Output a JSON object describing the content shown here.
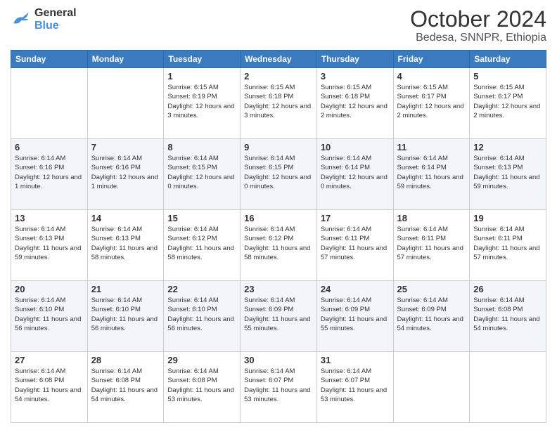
{
  "header": {
    "logo": {
      "general": "General",
      "blue": "Blue"
    },
    "month": "October 2024",
    "location": "Bedesa, SNNPR, Ethiopia"
  },
  "weekdays": [
    "Sunday",
    "Monday",
    "Tuesday",
    "Wednesday",
    "Thursday",
    "Friday",
    "Saturday"
  ],
  "weeks": [
    [
      {
        "day": "",
        "info": ""
      },
      {
        "day": "",
        "info": ""
      },
      {
        "day": "1",
        "info": "Sunrise: 6:15 AM\nSunset: 6:19 PM\nDaylight: 12 hours and 3 minutes."
      },
      {
        "day": "2",
        "info": "Sunrise: 6:15 AM\nSunset: 6:18 PM\nDaylight: 12 hours and 3 minutes."
      },
      {
        "day": "3",
        "info": "Sunrise: 6:15 AM\nSunset: 6:18 PM\nDaylight: 12 hours and 2 minutes."
      },
      {
        "day": "4",
        "info": "Sunrise: 6:15 AM\nSunset: 6:17 PM\nDaylight: 12 hours and 2 minutes."
      },
      {
        "day": "5",
        "info": "Sunrise: 6:15 AM\nSunset: 6:17 PM\nDaylight: 12 hours and 2 minutes."
      }
    ],
    [
      {
        "day": "6",
        "info": "Sunrise: 6:14 AM\nSunset: 6:16 PM\nDaylight: 12 hours and 1 minute."
      },
      {
        "day": "7",
        "info": "Sunrise: 6:14 AM\nSunset: 6:16 PM\nDaylight: 12 hours and 1 minute."
      },
      {
        "day": "8",
        "info": "Sunrise: 6:14 AM\nSunset: 6:15 PM\nDaylight: 12 hours and 0 minutes."
      },
      {
        "day": "9",
        "info": "Sunrise: 6:14 AM\nSunset: 6:15 PM\nDaylight: 12 hours and 0 minutes."
      },
      {
        "day": "10",
        "info": "Sunrise: 6:14 AM\nSunset: 6:14 PM\nDaylight: 12 hours and 0 minutes."
      },
      {
        "day": "11",
        "info": "Sunrise: 6:14 AM\nSunset: 6:14 PM\nDaylight: 11 hours and 59 minutes."
      },
      {
        "day": "12",
        "info": "Sunrise: 6:14 AM\nSunset: 6:13 PM\nDaylight: 11 hours and 59 minutes."
      }
    ],
    [
      {
        "day": "13",
        "info": "Sunrise: 6:14 AM\nSunset: 6:13 PM\nDaylight: 11 hours and 59 minutes."
      },
      {
        "day": "14",
        "info": "Sunrise: 6:14 AM\nSunset: 6:13 PM\nDaylight: 11 hours and 58 minutes."
      },
      {
        "day": "15",
        "info": "Sunrise: 6:14 AM\nSunset: 6:12 PM\nDaylight: 11 hours and 58 minutes."
      },
      {
        "day": "16",
        "info": "Sunrise: 6:14 AM\nSunset: 6:12 PM\nDaylight: 11 hours and 58 minutes."
      },
      {
        "day": "17",
        "info": "Sunrise: 6:14 AM\nSunset: 6:11 PM\nDaylight: 11 hours and 57 minutes."
      },
      {
        "day": "18",
        "info": "Sunrise: 6:14 AM\nSunset: 6:11 PM\nDaylight: 11 hours and 57 minutes."
      },
      {
        "day": "19",
        "info": "Sunrise: 6:14 AM\nSunset: 6:11 PM\nDaylight: 11 hours and 57 minutes."
      }
    ],
    [
      {
        "day": "20",
        "info": "Sunrise: 6:14 AM\nSunset: 6:10 PM\nDaylight: 11 hours and 56 minutes."
      },
      {
        "day": "21",
        "info": "Sunrise: 6:14 AM\nSunset: 6:10 PM\nDaylight: 11 hours and 56 minutes."
      },
      {
        "day": "22",
        "info": "Sunrise: 6:14 AM\nSunset: 6:10 PM\nDaylight: 11 hours and 56 minutes."
      },
      {
        "day": "23",
        "info": "Sunrise: 6:14 AM\nSunset: 6:09 PM\nDaylight: 11 hours and 55 minutes."
      },
      {
        "day": "24",
        "info": "Sunrise: 6:14 AM\nSunset: 6:09 PM\nDaylight: 11 hours and 55 minutes."
      },
      {
        "day": "25",
        "info": "Sunrise: 6:14 AM\nSunset: 6:09 PM\nDaylight: 11 hours and 54 minutes."
      },
      {
        "day": "26",
        "info": "Sunrise: 6:14 AM\nSunset: 6:08 PM\nDaylight: 11 hours and 54 minutes."
      }
    ],
    [
      {
        "day": "27",
        "info": "Sunrise: 6:14 AM\nSunset: 6:08 PM\nDaylight: 11 hours and 54 minutes."
      },
      {
        "day": "28",
        "info": "Sunrise: 6:14 AM\nSunset: 6:08 PM\nDaylight: 11 hours and 54 minutes."
      },
      {
        "day": "29",
        "info": "Sunrise: 6:14 AM\nSunset: 6:08 PM\nDaylight: 11 hours and 53 minutes."
      },
      {
        "day": "30",
        "info": "Sunrise: 6:14 AM\nSunset: 6:07 PM\nDaylight: 11 hours and 53 minutes."
      },
      {
        "day": "31",
        "info": "Sunrise: 6:14 AM\nSunset: 6:07 PM\nDaylight: 11 hours and 53 minutes."
      },
      {
        "day": "",
        "info": ""
      },
      {
        "day": "",
        "info": ""
      }
    ]
  ]
}
